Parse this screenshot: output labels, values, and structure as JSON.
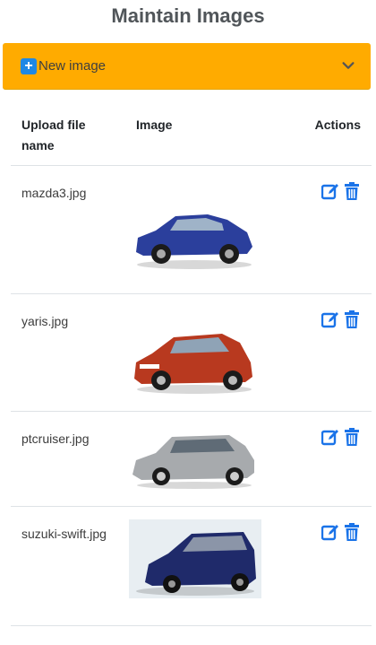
{
  "page": {
    "title": "Maintain Images"
  },
  "new_image": {
    "label": "New image",
    "plus_icon": "plus-square-icon",
    "expand_icon": "chevron-down-icon",
    "color": "#ffab00"
  },
  "table": {
    "headers": {
      "file_name": "Upload file name",
      "image": "Image",
      "actions": "Actions"
    },
    "rows": [
      {
        "file_name": "mazda3.jpg",
        "image": "blue hatchback car",
        "car_color": "#2b3f9c"
      },
      {
        "file_name": "yaris.jpg",
        "image": "orange-red hatchback car",
        "car_color": "#b8391f"
      },
      {
        "file_name": "ptcruiser.jpg",
        "image": "silver retro wagon car",
        "car_color": "#a7aaad"
      },
      {
        "file_name": "suzuki-swift.jpg",
        "image": "navy hatchback car photo",
        "car_color": "#1f2a6a"
      }
    ],
    "row_actions": {
      "edit_icon": "edit-icon",
      "delete_icon": "trash-icon",
      "icon_color": "#1a73e8"
    }
  }
}
